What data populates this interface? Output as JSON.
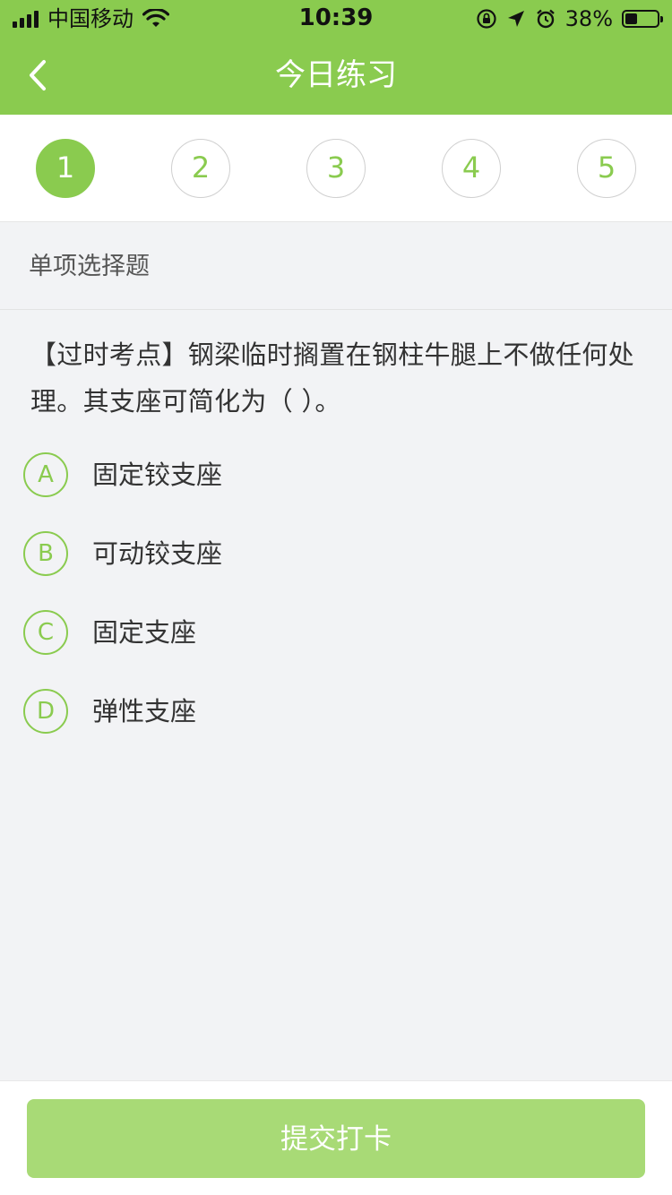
{
  "status_bar": {
    "carrier": "中国移动",
    "time": "10:39",
    "battery": "38%",
    "battery_level": 0.38,
    "icons": [
      "signal-icon",
      "wifi-icon",
      "rotation-lock-icon",
      "location-icon",
      "alarm-icon",
      "battery-icon"
    ]
  },
  "header": {
    "title": "今日练习",
    "back_icon": "chevron-left-icon"
  },
  "steps": [
    {
      "label": "1",
      "active": true
    },
    {
      "label": "2",
      "active": false
    },
    {
      "label": "3",
      "active": false
    },
    {
      "label": "4",
      "active": false
    },
    {
      "label": "5",
      "active": false
    }
  ],
  "question": {
    "type": "单项选择题",
    "text": "【过时考点】钢梁临时搁置在钢柱牛腿上不做任何处理。其支座可简化为（    ）。",
    "options": [
      {
        "letter": "A",
        "text": "固定铰支座"
      },
      {
        "letter": "B",
        "text": "可动铰支座"
      },
      {
        "letter": "C",
        "text": "固定支座"
      },
      {
        "letter": "D",
        "text": "弹性支座"
      }
    ]
  },
  "footer": {
    "submit_label": "提交打卡"
  },
  "colors": {
    "accent": "#8acb4f",
    "accent_light": "#a8da76",
    "background": "#f2f3f5"
  }
}
